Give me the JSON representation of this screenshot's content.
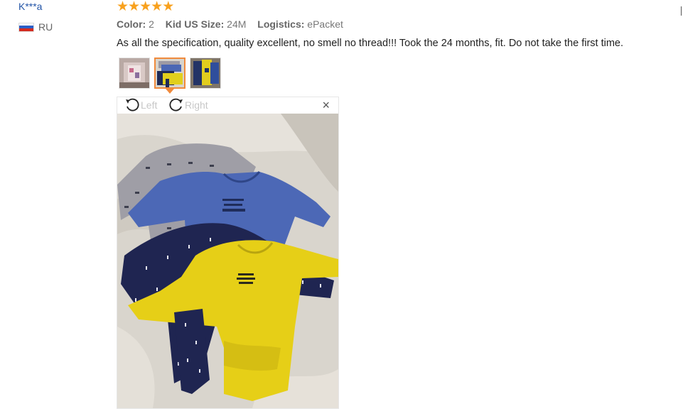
{
  "user": {
    "name": "K***a",
    "country_code": "RU",
    "flag_colors": [
      "#ffffff",
      "#2b5fc7",
      "#d52b1e"
    ]
  },
  "review": {
    "rating": 5,
    "star_color": "#f8a11e",
    "meta": [
      {
        "label": "Color:",
        "value": "2"
      },
      {
        "label": "Kid US Size:",
        "value": "24M"
      },
      {
        "label": "Logistics:",
        "value": "ePacket"
      }
    ],
    "text": "As all the specification, quality excellent, no smell no thread!!! Took the 24 months, fit. Do not take the first time."
  },
  "gallery": {
    "thumbnails": [
      {
        "name": "photo-1"
      },
      {
        "name": "photo-2",
        "selected": true
      },
      {
        "name": "photo-3"
      }
    ],
    "accent_color": "#f08a3c"
  },
  "viewer": {
    "rotate_left_label": "Left",
    "rotate_right_label": "Right",
    "close_glyph": "×"
  }
}
